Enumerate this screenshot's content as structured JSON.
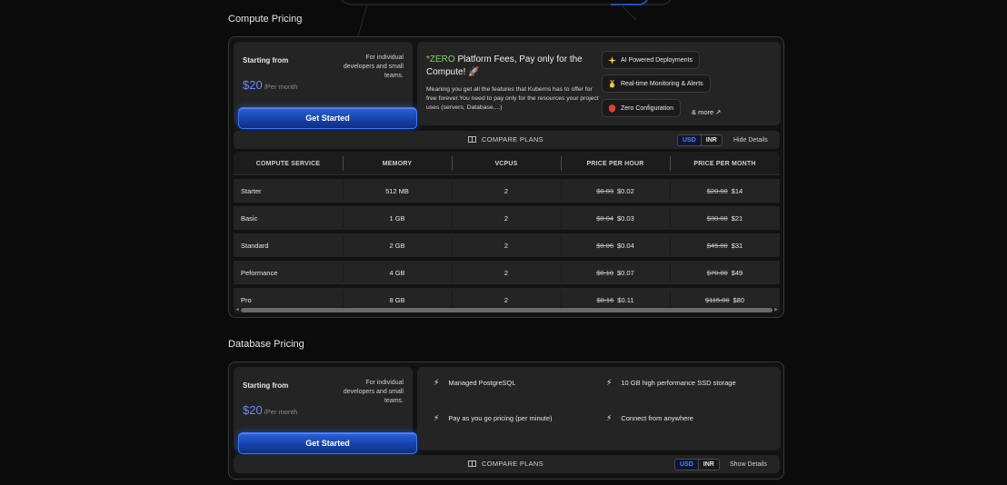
{
  "compute": {
    "title": "Compute Pricing",
    "card": {
      "starting_label": "Starting from",
      "audience": "For individual developers and small teams.",
      "price": "$20",
      "period": "/Per month",
      "cta": "Get Started"
    },
    "promo": {
      "highlight": "*ZERO",
      "headline": " Platform Fees, Pay only for the Compute! 🚀",
      "description": "Meaning you get all the features that Kuberns has to offer for free forever.You need to pay only for the resources your project uses (servers, Database....)",
      "chips": [
        {
          "icon": "sparkle-icon",
          "label": "AI Powered Deployments"
        },
        {
          "icon": "medal-icon",
          "label": "Real-time Monitoring & Alerts"
        },
        {
          "icon": "shield-icon",
          "label": "Zero Configuration"
        }
      ],
      "more": "& more ↗"
    },
    "compare": {
      "label": "COMPARE PLANS",
      "currency_usd": "USD",
      "currency_inr": "INR",
      "details_link": "Hide Details"
    },
    "table": {
      "headers": [
        "COMPUTE SERVICE",
        "MEMORY",
        "VCPUS",
        "PRICE PER HOUR",
        "PRICE PER MONTH"
      ],
      "rows": [
        {
          "name": "Starter",
          "memory": "512 MB",
          "vcpus": "2",
          "hour_old": "$0.03",
          "hour_new": "$0.02",
          "month_old": "$20.00",
          "month_new": "$14"
        },
        {
          "name": "Basic",
          "memory": "1 GB",
          "vcpus": "2",
          "hour_old": "$0.04",
          "hour_new": "$0.03",
          "month_old": "$30.00",
          "month_new": "$21"
        },
        {
          "name": "Standard",
          "memory": "2 GB",
          "vcpus": "2",
          "hour_old": "$0.06",
          "hour_new": "$0.04",
          "month_old": "$45.00",
          "month_new": "$31"
        },
        {
          "name": "Peformance",
          "memory": "4 GB",
          "vcpus": "2",
          "hour_old": "$0.10",
          "hour_new": "$0.07",
          "month_old": "$70.00",
          "month_new": "$49"
        },
        {
          "name": "Pro",
          "memory": "8 GB",
          "vcpus": "2",
          "hour_old": "$0.16",
          "hour_new": "$0.11",
          "month_old": "$115.00",
          "month_new": "$80"
        }
      ]
    }
  },
  "database": {
    "title": "Database Pricing",
    "card": {
      "starting_label": "Starting from",
      "audience": "For individual developers and small teams.",
      "price": "$20",
      "period": "/Per month",
      "cta": "Get Started"
    },
    "features": [
      "Managed PostgreSQL",
      "10 GB high performance SSD storage",
      "Pay as you go pricing (per minute)",
      "Connect from anywhere"
    ],
    "compare": {
      "label": "COMPARE PLANS",
      "currency_usd": "USD",
      "currency_inr": "INR",
      "details_link": "Show Details"
    }
  },
  "colors": {
    "background": "#0b0b0b",
    "card": "#242424",
    "accent_blue": "#6f86ff",
    "button_blue": "#1f55c8",
    "zero_green": "#7fd46a"
  }
}
